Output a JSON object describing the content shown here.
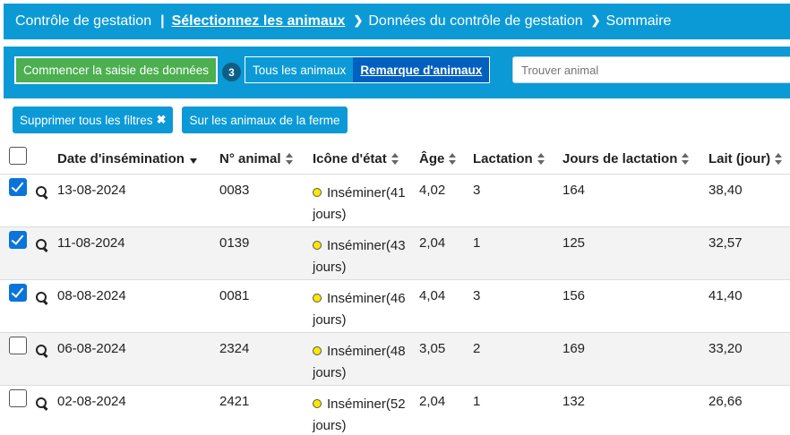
{
  "breadcrumb": {
    "step1": "Contrôle de gestation",
    "separator": "|",
    "step2": "Sélectionnez les animaux",
    "step3": "Données du contrôle de gestation",
    "step4": "Sommaire"
  },
  "toolbar": {
    "start_button": "Commencer la saisie des données",
    "selected_count": "3",
    "view_all": "Tous les animaux",
    "view_remark": "Remarque d'animaux",
    "search_placeholder": "Trouver animal"
  },
  "filters": {
    "clear_all": "Supprimer tous les filtres",
    "farm_animals": "Sur les animaux de la ferme"
  },
  "table": {
    "columns": [
      "Date d'insémination",
      "N° animal",
      "Icône d'état",
      "Âge",
      "Lactation",
      "Jours de lactation",
      "Lait (jour)"
    ],
    "sorted_column": "Date d'insémination",
    "rows": [
      {
        "checked": true,
        "date": "13-08-2024",
        "animal": "0083",
        "state": "Inséminer(41 jours)",
        "age": "4,02",
        "lactation": "3",
        "days": "164",
        "milk": "38,40"
      },
      {
        "checked": true,
        "date": "11-08-2024",
        "animal": "0139",
        "state": "Inséminer(43 jours)",
        "age": "2,04",
        "lactation": "1",
        "days": "125",
        "milk": "32,57"
      },
      {
        "checked": true,
        "date": "08-08-2024",
        "animal": "0081",
        "state": "Inséminer(46 jours)",
        "age": "4,04",
        "lactation": "3",
        "days": "156",
        "milk": "41,40"
      },
      {
        "checked": false,
        "date": "06-08-2024",
        "animal": "2324",
        "state": "Inséminer(48 jours)",
        "age": "3,05",
        "lactation": "2",
        "days": "169",
        "milk": "33,20"
      },
      {
        "checked": false,
        "date": "02-08-2024",
        "animal": "2421",
        "state": "Inséminer(52 jours)",
        "age": "2,04",
        "lactation": "1",
        "days": "132",
        "milk": "26,66"
      }
    ]
  },
  "colors": {
    "brand_blue": "#0b9ad6",
    "start_green": "#4caf50",
    "active_segment": "#0060c0",
    "checkbox_blue": "#0a74da",
    "state_dot": "#ffe600"
  }
}
